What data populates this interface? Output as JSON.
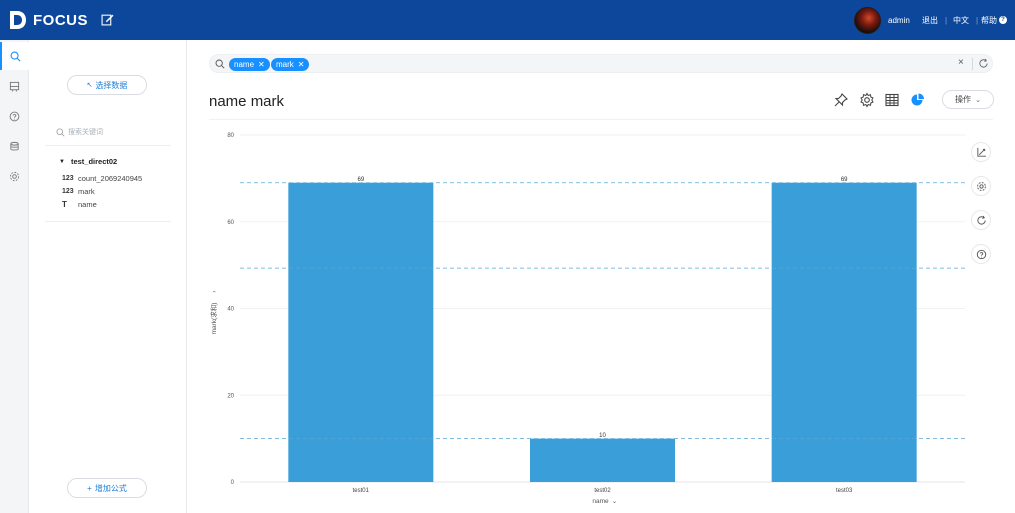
{
  "app": {
    "name": "FOCUS"
  },
  "topbar": {
    "user": "admin",
    "logout": "退出",
    "language": "中文",
    "help": "帮助",
    "sep": "|"
  },
  "sidebar": {
    "rail": [
      "search-icon",
      "board-icon",
      "question-icon",
      "database-icon",
      "settings-icon"
    ],
    "select_data": "选择数据",
    "search_placeholder": "搜索关键词",
    "table_name": "test_direct02",
    "fields": [
      {
        "type": "123",
        "name": "count_2069240945"
      },
      {
        "type": "123",
        "name": "mark"
      },
      {
        "type": "T",
        "name": "name"
      }
    ],
    "add_formula": "增加公式"
  },
  "search": {
    "tags": [
      "name",
      "mark"
    ]
  },
  "main": {
    "title": "name mark",
    "operation": "操作"
  },
  "colors": {
    "topbar": "#0c479c",
    "accent": "#1890ff",
    "bar": "#3a9fd8"
  },
  "chart_data": {
    "type": "bar",
    "categories": [
      "test01",
      "test02",
      "test03"
    ],
    "values": [
      69,
      10,
      69
    ],
    "data_labels": [
      "69",
      "10",
      "69"
    ],
    "xlabel": "name",
    "ylabel": "mark(求和)",
    "yticks": [
      "0",
      "20",
      "40",
      "60",
      "80"
    ],
    "ylim": [
      0,
      80
    ],
    "reference_lines": [
      69,
      49.3,
      10
    ],
    "grid": true
  }
}
